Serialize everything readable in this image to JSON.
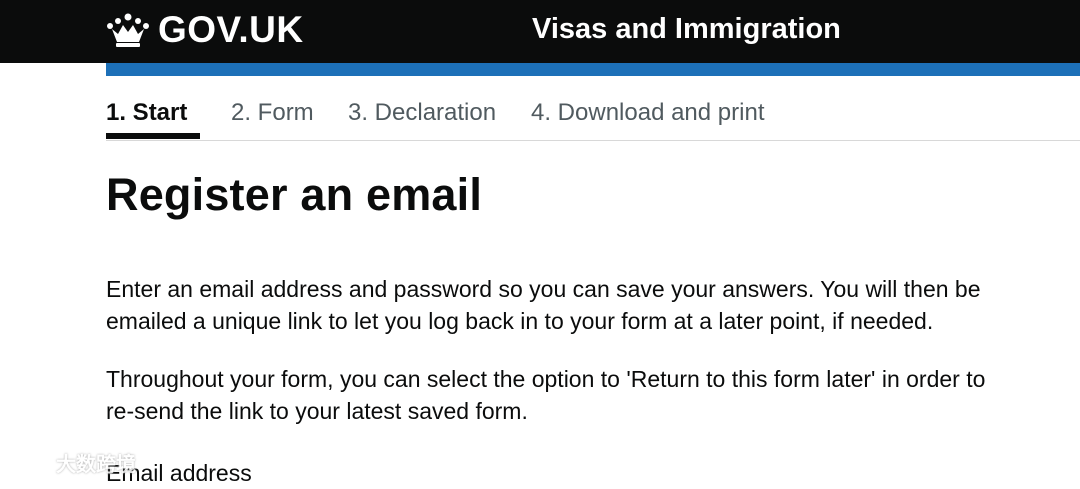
{
  "header": {
    "logo_text": "GOV.UK",
    "service_name": "Visas and Immigration",
    "colors": {
      "background": "#0b0c0c",
      "accent_bar": "#1d70b8"
    }
  },
  "steps": [
    {
      "label": "1.  Start",
      "active": true
    },
    {
      "label": "2. Form",
      "active": false
    },
    {
      "label": "3. Declaration",
      "active": false
    },
    {
      "label": "4. Download and print",
      "active": false
    }
  ],
  "main": {
    "title": "Register an email",
    "paragraph_1": "Enter an email address and password so you can save your answers. You will then be emailed a unique link to let you log back in to your form at a later point, if needed.",
    "paragraph_2": "Throughout your form, you can select the option to 'Return to this form later' in order to re-send the link to your latest saved form.",
    "email_label": "Email address"
  },
  "watermark": {
    "text": "大数跨境",
    "icon": "watermark-logo-icon"
  }
}
